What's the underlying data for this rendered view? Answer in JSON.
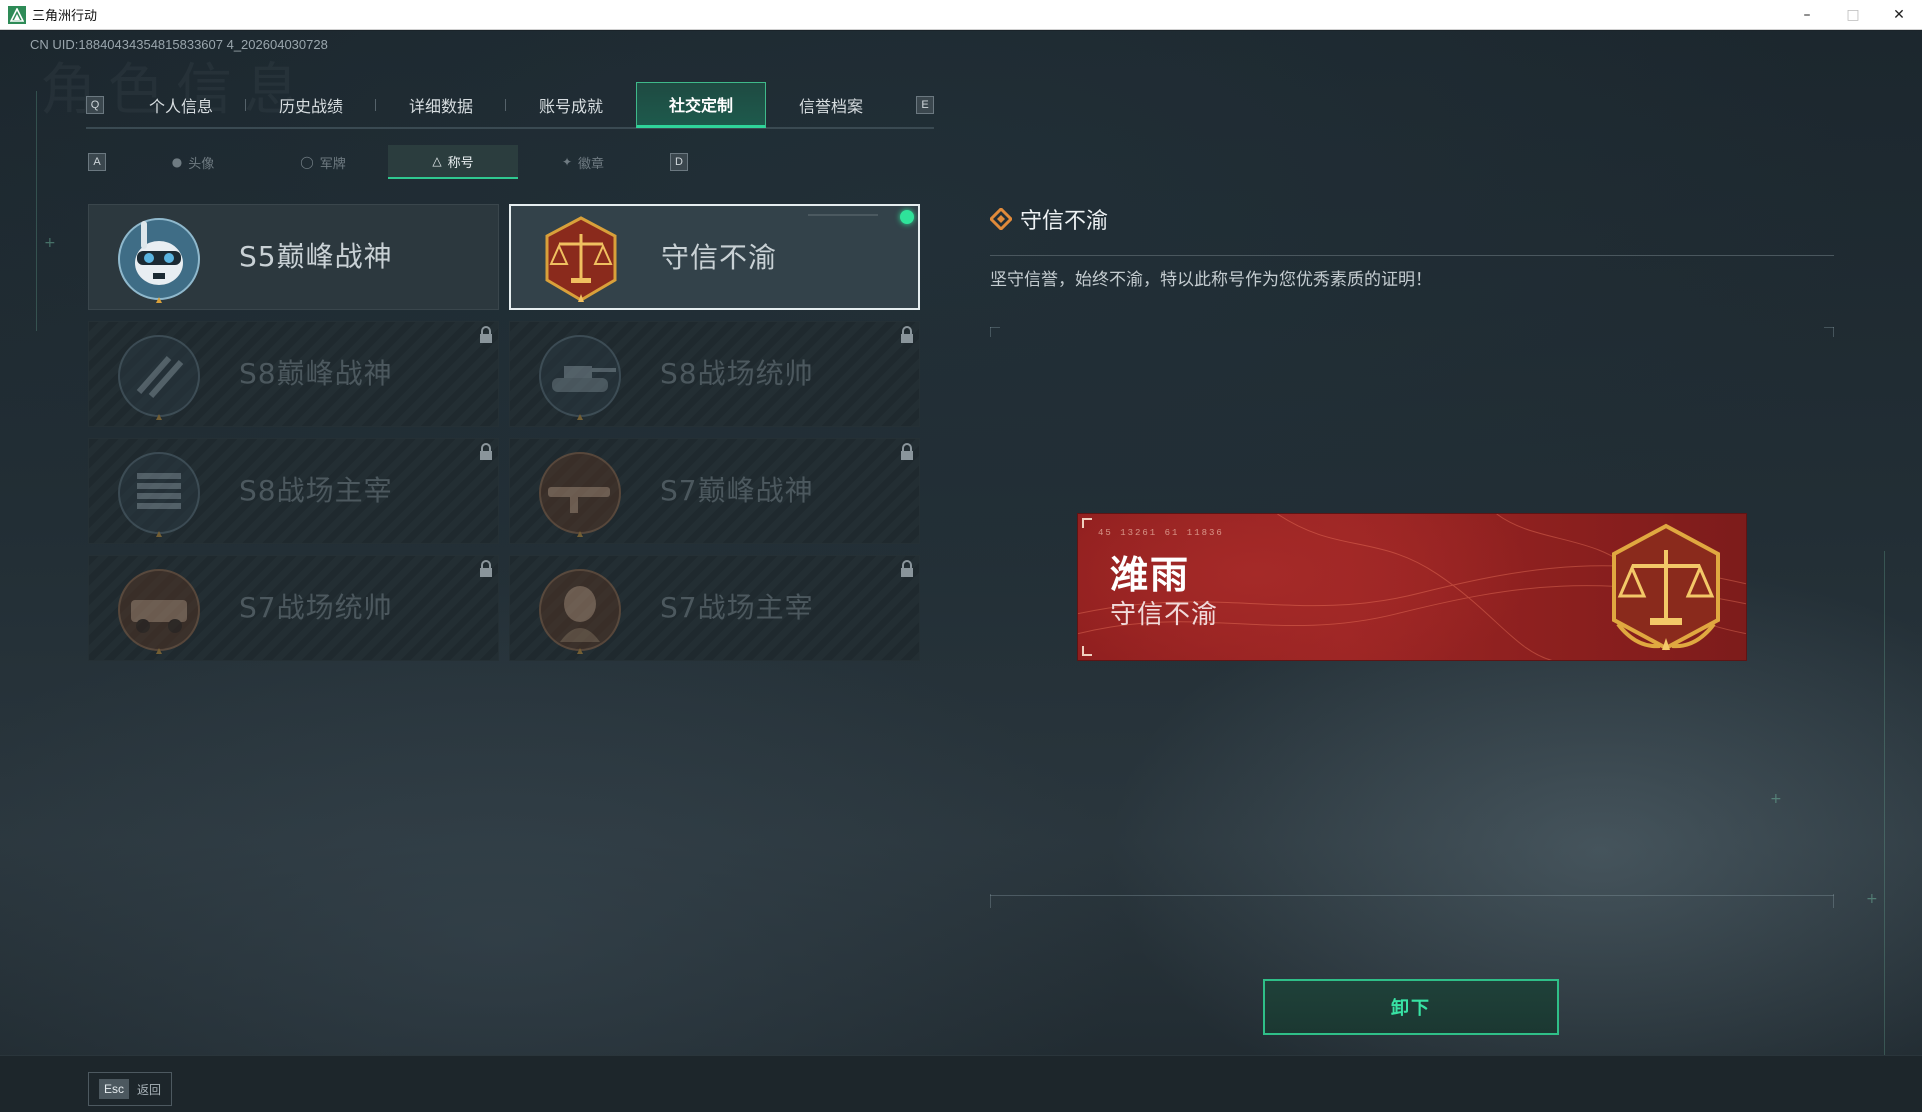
{
  "window": {
    "title": "三角洲行动",
    "minimize": "–",
    "maximize": "□",
    "close": "✕"
  },
  "uid": "CN UID:18840434354815833607 4_202604030728",
  "background_heading": "角色信息",
  "main_tabs": {
    "left_key": "Q",
    "right_key": "E",
    "items": [
      {
        "label": "个人信息"
      },
      {
        "label": "历史战绩"
      },
      {
        "label": "详细数据"
      },
      {
        "label": "账号成就"
      },
      {
        "label": "社交定制"
      },
      {
        "label": "信誉档案"
      }
    ],
    "active_index": 4
  },
  "sub_tabs": {
    "left_key": "A",
    "right_key": "D",
    "items": [
      {
        "label": "头像",
        "icon": "person-icon"
      },
      {
        "label": "军牌",
        "icon": "dogtag-icon"
      },
      {
        "label": "称号",
        "icon": "triangle-icon"
      },
      {
        "label": "徽章",
        "icon": "badge-icon"
      }
    ],
    "active_index": 2
  },
  "titles": [
    {
      "label": "S5巅峰战神",
      "emblem": "skull-diver-emblem",
      "locked": false,
      "selected": false
    },
    {
      "label": "守信不渝",
      "emblem": "scales-emblem",
      "locked": false,
      "selected": true
    },
    {
      "label": "S8巅峰战神",
      "emblem": "stripes-emblem",
      "locked": true,
      "selected": false
    },
    {
      "label": "S8战场统帅",
      "emblem": "tank-emblem",
      "locked": true,
      "selected": false
    },
    {
      "label": "S8战场主宰",
      "emblem": "rocket-launcher-emblem",
      "locked": true,
      "selected": false
    },
    {
      "label": "S7巅峰战神",
      "emblem": "rifle-emblem",
      "locked": true,
      "selected": false
    },
    {
      "label": "S7战场统帅",
      "emblem": "vehicle-emblem",
      "locked": true,
      "selected": false
    },
    {
      "label": "S7战场主宰",
      "emblem": "soldier-emblem",
      "locked": true,
      "selected": false
    }
  ],
  "detail": {
    "title": "守信不渝",
    "description": "坚守信誉，始终不渝，特以此称号作为您优秀素质的证明！"
  },
  "nameplate": {
    "player_name": "潍雨",
    "title": "守信不渝",
    "code": "45 13261  61 11836"
  },
  "unequip_label": "卸下",
  "bottom": {
    "esc_key": "Esc",
    "esc_label": "返回"
  },
  "colors": {
    "accent_green": "#2fd49a",
    "plate_red": "#9c2524",
    "gold": "#d9a03a"
  }
}
